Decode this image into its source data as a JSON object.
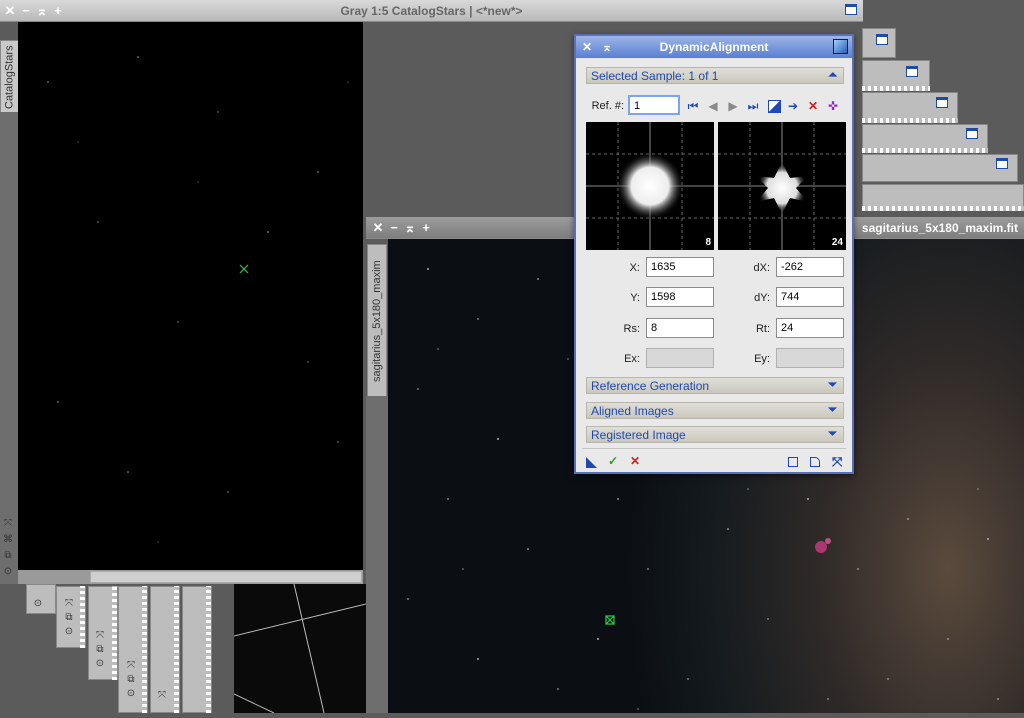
{
  "catalog_window": {
    "title": "Gray 1:5 CatalogStars | <*new*>",
    "tab_label": "CatalogStars"
  },
  "sag_window": {
    "title": "sagitarius_5x180_maxim.fit",
    "tab_label": "sagitarius_5x180_maxim"
  },
  "dialog": {
    "title": "DynamicAlignment",
    "selected_sample": "Selected Sample: 1 of 1",
    "ref_label": "Ref. #:",
    "ref_value": "1",
    "preview_left_num": "8",
    "preview_right_num": "24",
    "fields": {
      "x_label": "X:",
      "x_value": "1635",
      "dx_label": "dX:",
      "dx_value": "-262",
      "y_label": "Y:",
      "y_value": "1598",
      "dy_label": "dY:",
      "dy_value": "744",
      "rs_label": "Rs:",
      "rs_value": "8",
      "rt_label": "Rt:",
      "rt_value": "24",
      "ex_label": "Ex:",
      "ex_value": "",
      "ey_label": "Ey:",
      "ey_value": ""
    },
    "sections": {
      "reference_generation": "Reference Generation",
      "aligned_images": "Aligned Images",
      "registered_image": "Registered Image"
    }
  },
  "icons": {
    "close": "✕",
    "minimize": "−",
    "shade": "⌅",
    "maximize": "+",
    "first": "⏮",
    "prev": "◀",
    "next": "▶",
    "last": "⏭",
    "chev_up": "⏶",
    "chev_down": "⏷",
    "ok": "✓",
    "cancel": "✕",
    "arrow_right": "➔",
    "crosshair": "✜"
  },
  "colors": {
    "accent": "#1f49b0",
    "dialog_title": "#5a7fd0",
    "ok_green": "#2a9a2a",
    "delete_red": "#d02020",
    "marker_green": "#33cc44"
  }
}
